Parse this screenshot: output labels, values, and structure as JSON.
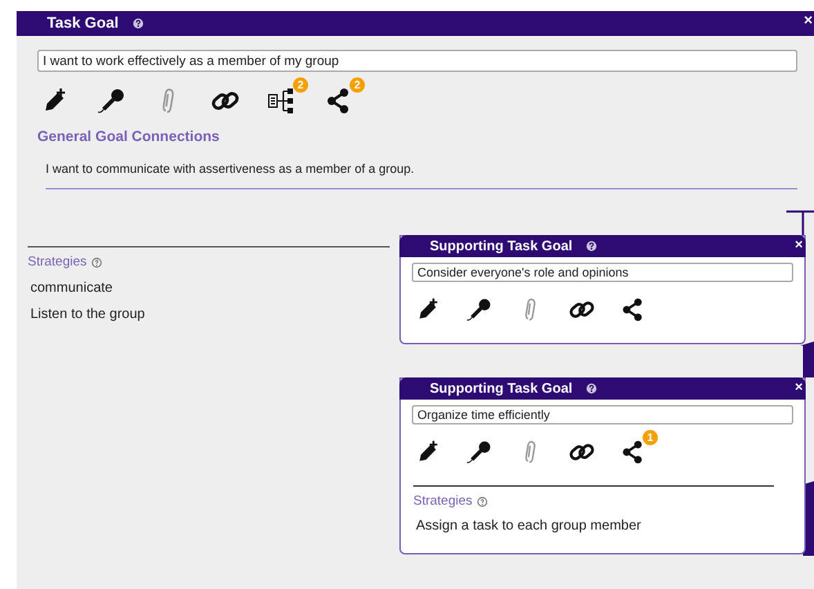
{
  "task_goal": {
    "title": "Task Goal",
    "close": "×",
    "value": "I want to work effectively as a member of my group",
    "tools": [
      {
        "kind": "edit",
        "disabled": false
      },
      {
        "kind": "mic",
        "disabled": false
      },
      {
        "kind": "attach",
        "disabled": true
      },
      {
        "kind": "link",
        "disabled": false
      },
      {
        "kind": "tree",
        "disabled": false,
        "badge": "2"
      },
      {
        "kind": "share",
        "disabled": false,
        "badge": "2"
      }
    ],
    "connections_heading": "General Goal Connections",
    "connections": [
      "I want to communicate with assertiveness as a member of a group."
    ]
  },
  "strategies": {
    "heading": "Strategies",
    "items": [
      "communicate",
      "Listen to the group"
    ]
  },
  "supporting_goals": [
    {
      "title": "Supporting Task Goal",
      "close": "×",
      "value": "Consider everyone's role and opinions",
      "tools": [
        {
          "kind": "edit",
          "disabled": false
        },
        {
          "kind": "mic",
          "disabled": false
        },
        {
          "kind": "attach",
          "disabled": true
        },
        {
          "kind": "link",
          "disabled": false
        },
        {
          "kind": "share",
          "disabled": false
        }
      ]
    },
    {
      "title": "Supporting Task Goal",
      "close": "×",
      "value": "Organize time efficiently",
      "tools": [
        {
          "kind": "edit",
          "disabled": false
        },
        {
          "kind": "mic",
          "disabled": false
        },
        {
          "kind": "attach",
          "disabled": true
        },
        {
          "kind": "link",
          "disabled": false
        },
        {
          "kind": "share",
          "disabled": false,
          "badge": "1"
        }
      ],
      "strategies": {
        "heading": "Strategies",
        "items": [
          "Assign a task to each group member"
        ]
      }
    }
  ]
}
